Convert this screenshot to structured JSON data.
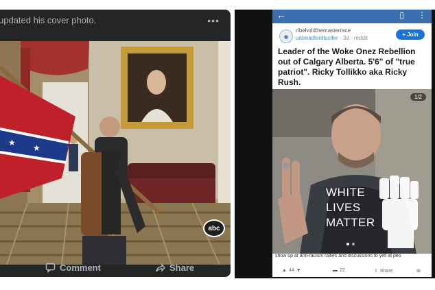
{
  "left_post": {
    "header_text": "updated his cover photo.",
    "more_icon": "more-dots-icon",
    "photo_watermark": "abc",
    "actions": [
      {
        "label": "Comment",
        "icon": "comment-icon"
      },
      {
        "label": "Share",
        "icon": "share-icon"
      }
    ],
    "colors": {
      "card_bg": "#242526",
      "text": "#b0b3b8"
    }
  },
  "right_post": {
    "topbar_color": "#3b6fb0",
    "subreddit": "r/beholdthemasterrace",
    "author": "u/dreadlordlucifer",
    "meta": " · 3d · reddit",
    "join_label": "+ Join",
    "title": "Leader of the Woke Onez Rebellion out of Calgary Alberta. 5'6\" of \"true patriot\". Ricky Tollikko aka Ricky Rush.",
    "image_counter": "1/2",
    "overlay_lines": [
      "WHITE",
      "LIVES",
      "MATTER"
    ],
    "caption": "show up at anti-racism rallies and discussions to yell at peo",
    "votes": "44",
    "comments": "22",
    "share_label": "Share"
  }
}
